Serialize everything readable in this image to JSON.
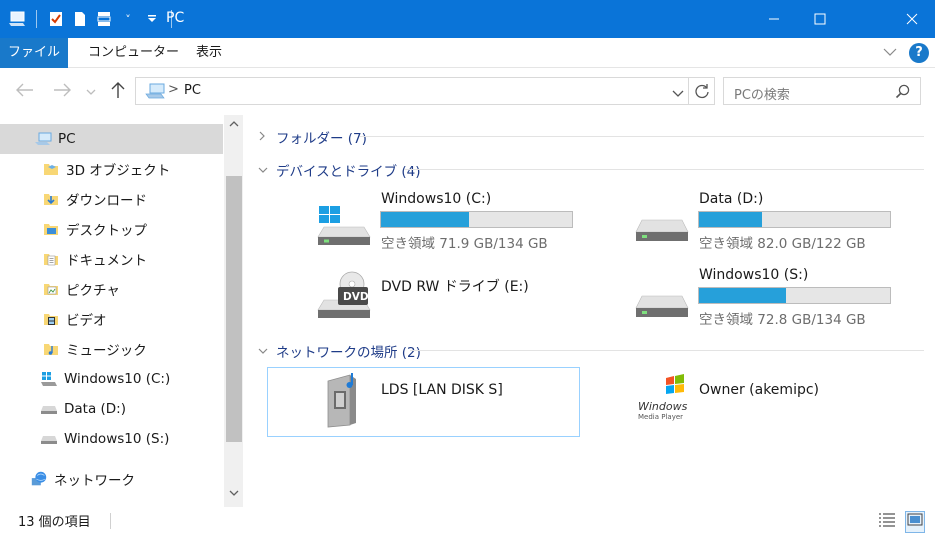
{
  "window": {
    "title": "PC",
    "quick_access_dropdown": "˅",
    "controls": {
      "minimize": "—",
      "maximize": "☐",
      "close": "✕"
    }
  },
  "ribbon": {
    "tabs": [
      {
        "label": "ファイル"
      },
      {
        "label": "コンピューター"
      },
      {
        "label": "表示"
      }
    ],
    "help": "?"
  },
  "nav": {
    "address": "PC",
    "address_sep": ">",
    "search_placeholder": "PCの検索"
  },
  "sidebar": {
    "items": [
      {
        "label": "PC",
        "icon": "pc-icon"
      },
      {
        "label": "3D オブジェクト",
        "icon": "folder-3d-icon"
      },
      {
        "label": "ダウンロード",
        "icon": "download-folder-icon"
      },
      {
        "label": "デスクトップ",
        "icon": "desktop-folder-icon"
      },
      {
        "label": "ドキュメント",
        "icon": "documents-folder-icon"
      },
      {
        "label": "ピクチャ",
        "icon": "pictures-folder-icon"
      },
      {
        "label": "ビデオ",
        "icon": "videos-folder-icon"
      },
      {
        "label": "ミュージック",
        "icon": "music-folder-icon"
      },
      {
        "label": "Windows10 (C:)",
        "icon": "windows-drive-icon"
      },
      {
        "label": "Data (D:)",
        "icon": "drive-icon"
      },
      {
        "label": "Windows10 (S:)",
        "icon": "drive-icon"
      },
      {
        "label": "ネットワーク",
        "icon": "network-icon"
      }
    ]
  },
  "groups": {
    "folders": "フォルダー (7)",
    "devices": "デバイスとドライブ (4)",
    "network": "ネットワークの場所 (2)"
  },
  "drives": [
    {
      "name": "Windows10 (C:)",
      "free": "空き領域 71.9 GB/134 GB",
      "used_fraction": 0.463,
      "icon": "windows-hdd-icon"
    },
    {
      "name": "Data (D:)",
      "free": "空き領域 82.0 GB/122 GB",
      "used_fraction": 0.328,
      "icon": "hdd-icon"
    },
    {
      "name": "DVD RW ドライブ (E:)",
      "icon": "dvd-drive-icon",
      "dvd_label": "DVD"
    },
    {
      "name": "Windows10 (S:)",
      "free": "空き領域 72.8 GB/134 GB",
      "used_fraction": 0.457,
      "icon": "hdd-icon"
    }
  ],
  "network_locations": [
    {
      "name": "LDS [LAN DISK S]",
      "icon": "media-server-icon"
    },
    {
      "name": "Owner (akemipc)",
      "icon": "windows-media-player-icon",
      "logo_text": "Windows",
      "logo_subtext": "Media Player"
    }
  ],
  "status": {
    "count": "13 個の項目"
  },
  "colors": {
    "titlebar": "#0a74d8",
    "accent": "#26a0da",
    "group_header": "#1f3c88"
  }
}
